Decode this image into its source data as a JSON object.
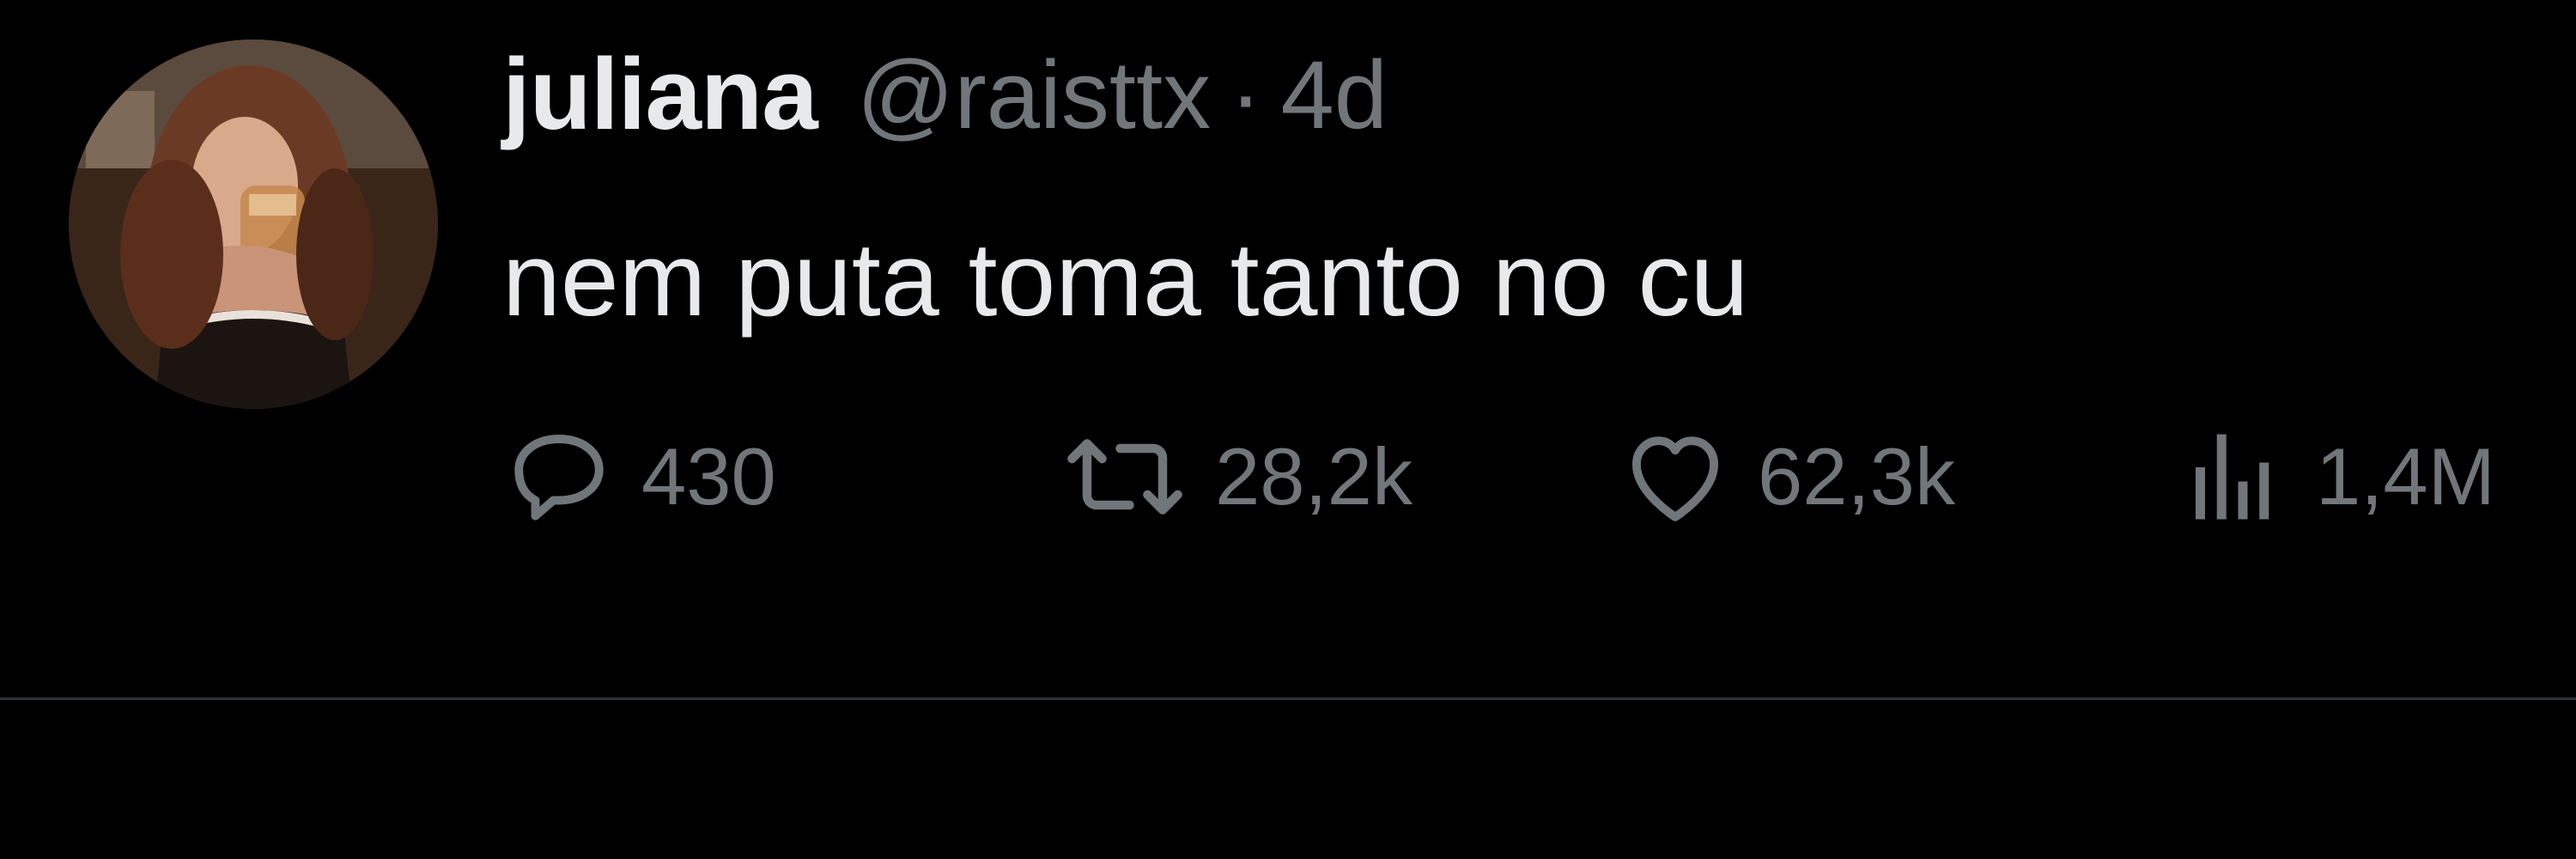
{
  "tweet": {
    "author": {
      "display_name": "juliana",
      "handle": "@raisttx",
      "avatar_icon": "profile-photo"
    },
    "separator": "·",
    "time": "4d",
    "text": "nem puta toma tanto no cu",
    "actions": {
      "reply": {
        "icon": "reply-bubble-icon",
        "count": "430"
      },
      "retweet": {
        "icon": "retweet-arrows-icon",
        "count": "28,2k"
      },
      "like": {
        "icon": "heart-outline-icon",
        "count": "62,3k"
      },
      "views": {
        "icon": "bar-chart-icon",
        "count": "1,4M"
      }
    }
  },
  "colors": {
    "background": "#000000",
    "primary_text": "#e7e9ea",
    "secondary_text": "#71767b",
    "divider": "#2f3336"
  }
}
